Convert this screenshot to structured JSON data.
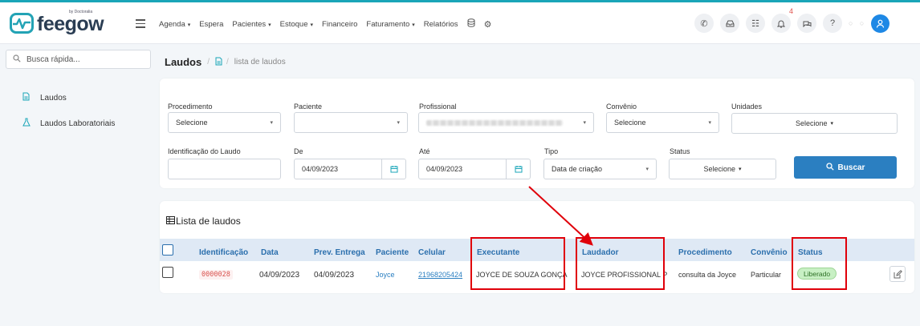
{
  "brand": {
    "name": "feegow",
    "by": "by Doctoralia",
    "accent": "#1aa5b8",
    "navy": "#2a3d53"
  },
  "nav": {
    "items": [
      {
        "label": "Agenda",
        "caret": "▾"
      },
      {
        "label": "Espera",
        "caret": ""
      },
      {
        "label": "Pacientes",
        "caret": "▾"
      },
      {
        "label": "Estoque",
        "caret": "▾"
      },
      {
        "label": "Financeiro",
        "caret": ""
      },
      {
        "label": "Faturamento",
        "caret": "▾"
      },
      {
        "label": "Relatórios",
        "caret": ""
      }
    ],
    "icons": [
      "database-icon",
      "settings-icon"
    ]
  },
  "top_icons": {
    "items": [
      "phone-icon",
      "inbox-icon",
      "checklist-icon",
      "bell-icon",
      "chat-icon",
      "help-icon"
    ],
    "notification_count": "4"
  },
  "sidebar": {
    "search_placeholder": "Busca rápida...",
    "items": [
      {
        "label": "Laudos",
        "icon": "document-icon"
      },
      {
        "label": "Laudos Laboratoriais",
        "icon": "flask-icon"
      }
    ]
  },
  "breadcrumb": {
    "title": "Laudos",
    "separator": "/",
    "current": "lista de laudos"
  },
  "filters": {
    "procedimento": {
      "label": "Procedimento",
      "value": "Selecione"
    },
    "paciente": {
      "label": "Paciente",
      "value": ""
    },
    "profissional": {
      "label": "Profissional",
      "value": ""
    },
    "convenio": {
      "label": "Convênio",
      "value": "Selecione"
    },
    "unidades": {
      "label": "Unidades",
      "value": "Selecione"
    },
    "identificacao": {
      "label": "Identificação do Laudo",
      "value": ""
    },
    "de": {
      "label": "De",
      "value": "04/09/2023"
    },
    "ate": {
      "label": "Até",
      "value": "04/09/2023"
    },
    "tipo": {
      "label": "Tipo",
      "value": "Data de criação"
    },
    "status": {
      "label": "Status",
      "value": "Selecione"
    },
    "search_button": "Buscar"
  },
  "list": {
    "title": "Lista de laudos",
    "columns": [
      "Identificação",
      "Data",
      "Prev. Entrega",
      "Paciente",
      "Celular",
      "Executante",
      "Laudador",
      "Procedimento",
      "Convênio",
      "Status"
    ],
    "rows": [
      {
        "identificacao": "0000028",
        "data": "04/09/2023",
        "prev_entrega": "04/09/2023",
        "paciente": "Joyce",
        "celular": "21968205424",
        "executante": "JOYCE DE SOUZA GONÇA",
        "laudador": "JOYCE PROFISSIONAL P",
        "procedimento": "consulta da Joyce",
        "convenio": "Particular",
        "status": "Liberado"
      }
    ]
  },
  "highlight_color": "#e0000a"
}
